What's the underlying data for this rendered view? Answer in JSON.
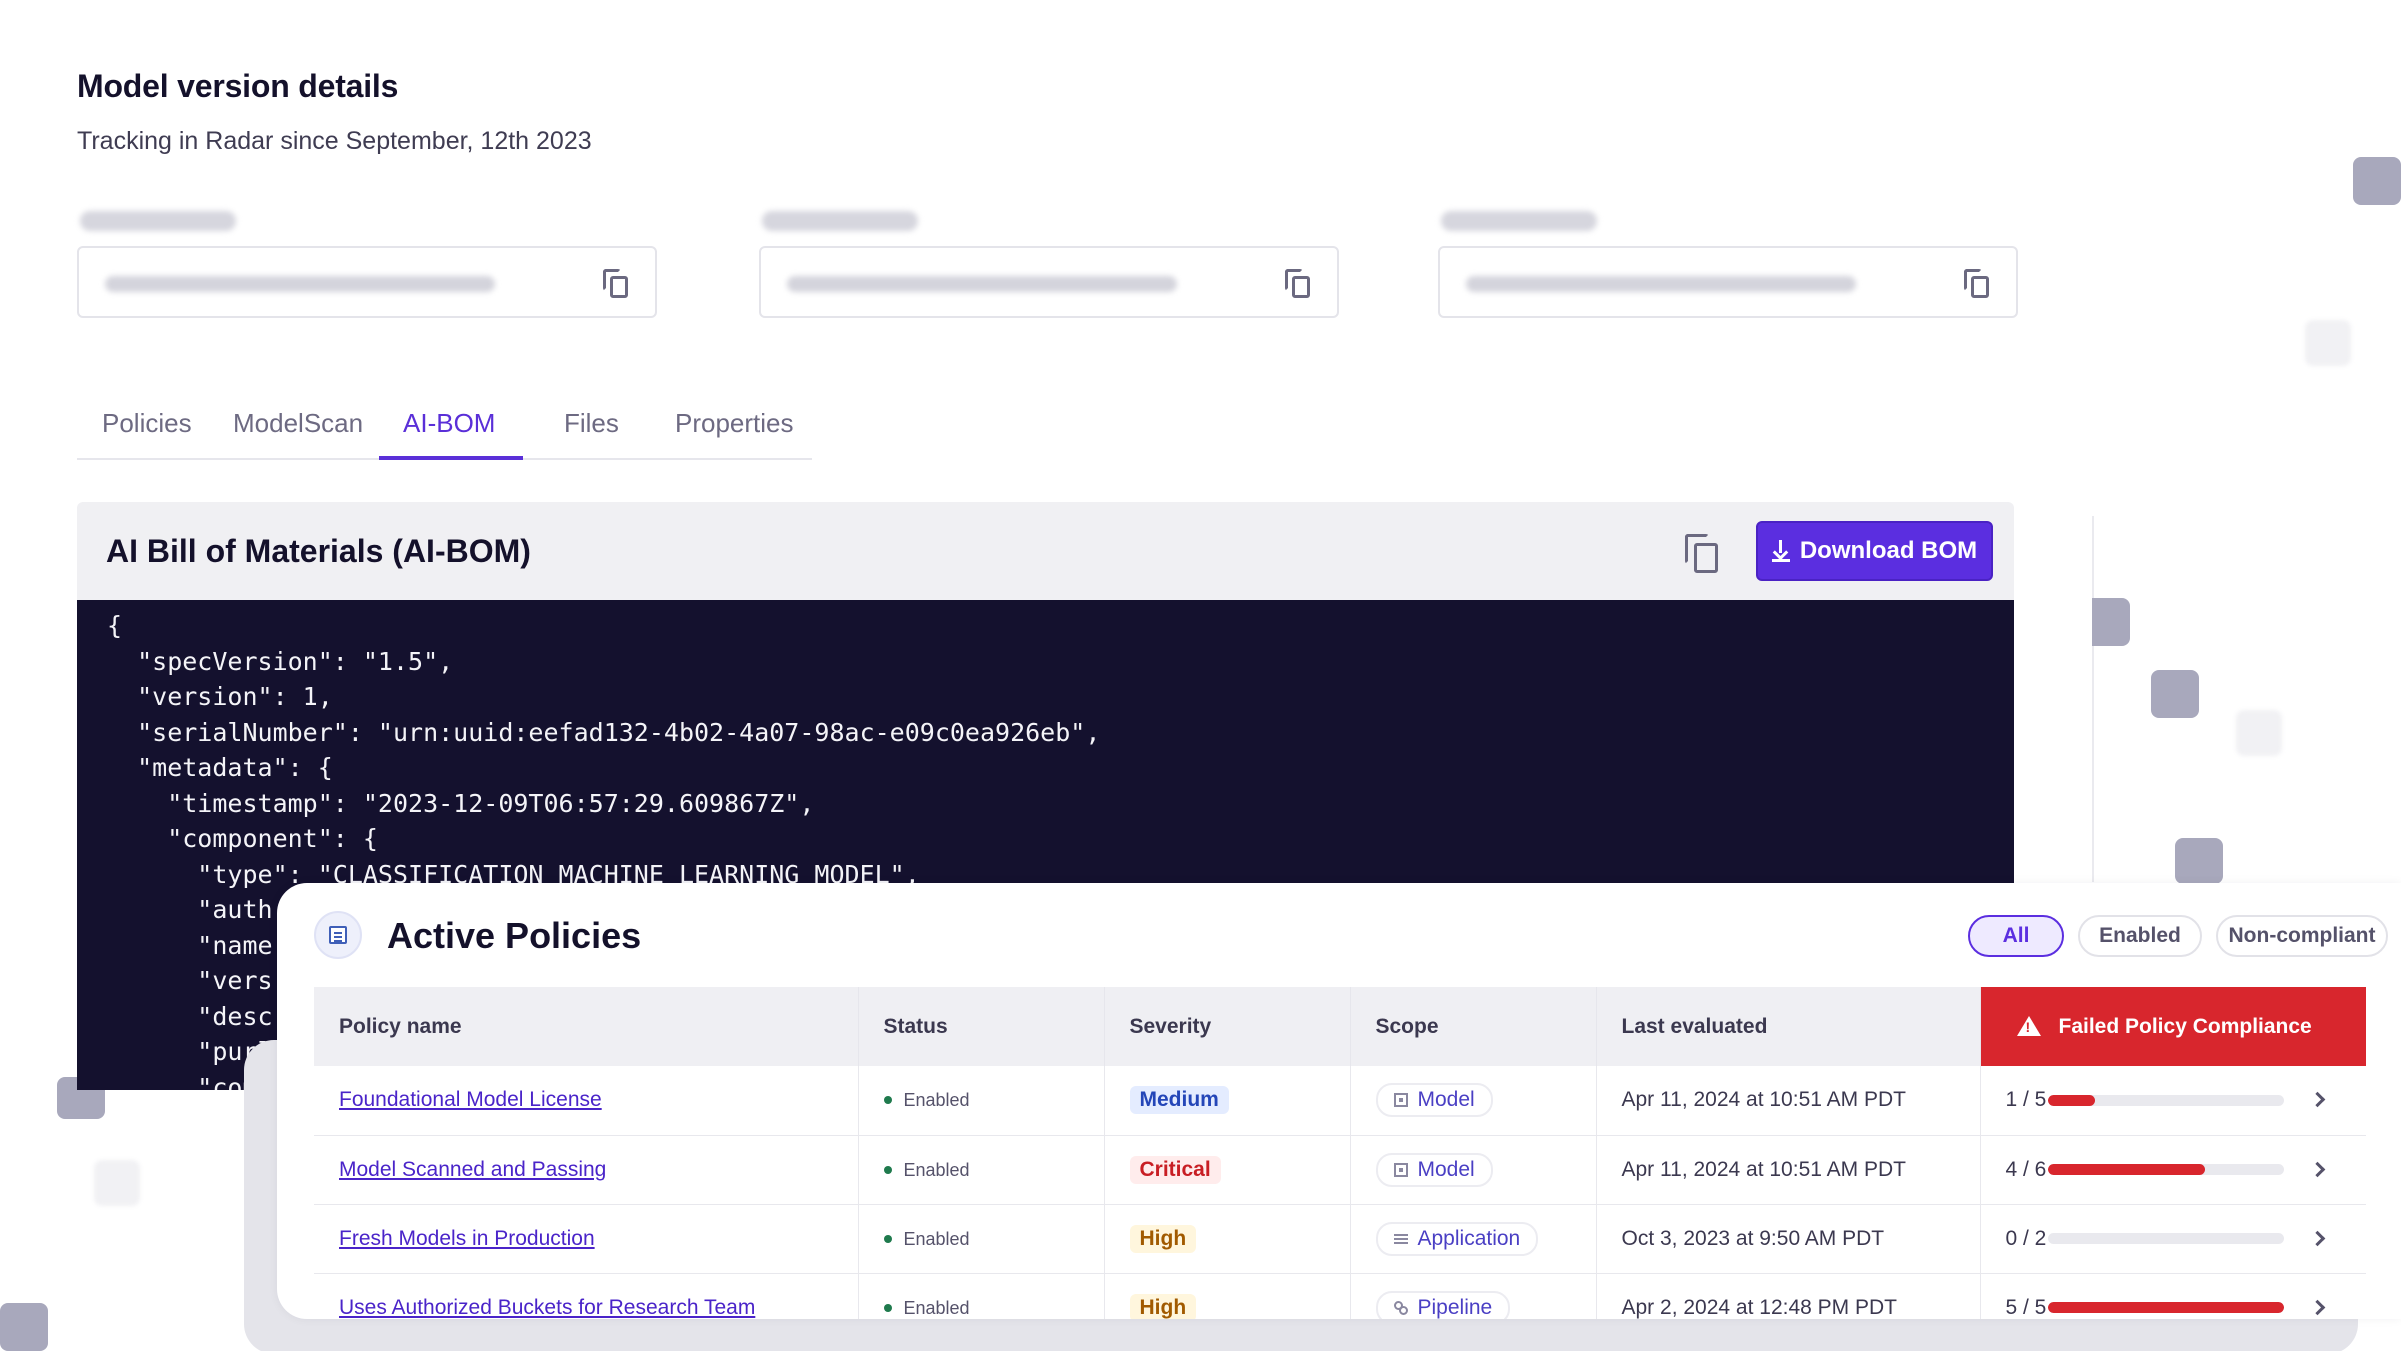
{
  "header": {
    "title": "Model version details",
    "subtitle": "Tracking in Radar since September, 12th 2023"
  },
  "tabs": [
    {
      "label": "Policies",
      "active": false
    },
    {
      "label": "ModelScan",
      "active": false
    },
    {
      "label": "AI-BOM",
      "active": true
    },
    {
      "label": "Files",
      "active": false
    },
    {
      "label": "Properties",
      "active": false
    }
  ],
  "bom": {
    "title": "AI Bill of Materials (AI-BOM)",
    "download_label": "Download BOM",
    "code": "{\n  \"specVersion\": \"1.5\",\n  \"version\": 1,\n  \"serialNumber\": \"urn:uuid:eefad132-4b02-4a07-98ac-e09c0ea926eb\",\n  \"metadata\": {\n    \"timestamp\": \"2023-12-09T06:57:29.609867Z\",\n    \"component\": {\n      \"type\": \"CLASSIFICATION_MACHINE_LEARNING_MODEL\",\n      \"auth\n      \"name\n      \"vers\n      \"desc\n      \"purl\n      \"comp"
  },
  "policies": {
    "title": "Active Policies",
    "filters": [
      "All",
      "Enabled",
      "Non-compliant"
    ],
    "active_filter": "All",
    "columns": [
      "Policy name",
      "Status",
      "Severity",
      "Scope",
      "Last evaluated",
      "Failed Policy Compliance"
    ],
    "rows": [
      {
        "name": "Foundational Model License",
        "status": "Enabled",
        "severity": "Medium",
        "scope": "Model",
        "scope_icon": "model-icon",
        "last_evaluated": "Apr 11, 2024 at 10:51 AM PDT",
        "ratio": "1 / 5",
        "failed": 1,
        "total": 5
      },
      {
        "name": "Model Scanned and Passing",
        "status": "Enabled",
        "severity": "Critical",
        "scope": "Model",
        "scope_icon": "model-icon",
        "last_evaluated": "Apr 11, 2024 at 10:51 AM PDT",
        "ratio": "4 / 6",
        "failed": 4,
        "total": 6
      },
      {
        "name": "Fresh Models in Production",
        "status": "Enabled",
        "severity": "High",
        "scope": "Application",
        "scope_icon": "application-icon",
        "last_evaluated": "Oct 3, 2023 at 9:50 AM PDT",
        "ratio": "0 / 2",
        "failed": 0,
        "total": 2
      },
      {
        "name": "Uses Authorized Buckets for Research Team",
        "status": "Enabled",
        "severity": "High",
        "scope": "Pipeline",
        "scope_icon": "pipeline-icon",
        "last_evaluated": "Apr 2, 2024 at 12:48 PM PDT",
        "ratio": "5 / 5",
        "failed": 5,
        "total": 5
      }
    ]
  },
  "colors": {
    "accent": "#5b2ee0",
    "danger": "#d8262d",
    "code_bg": "#14112e"
  }
}
